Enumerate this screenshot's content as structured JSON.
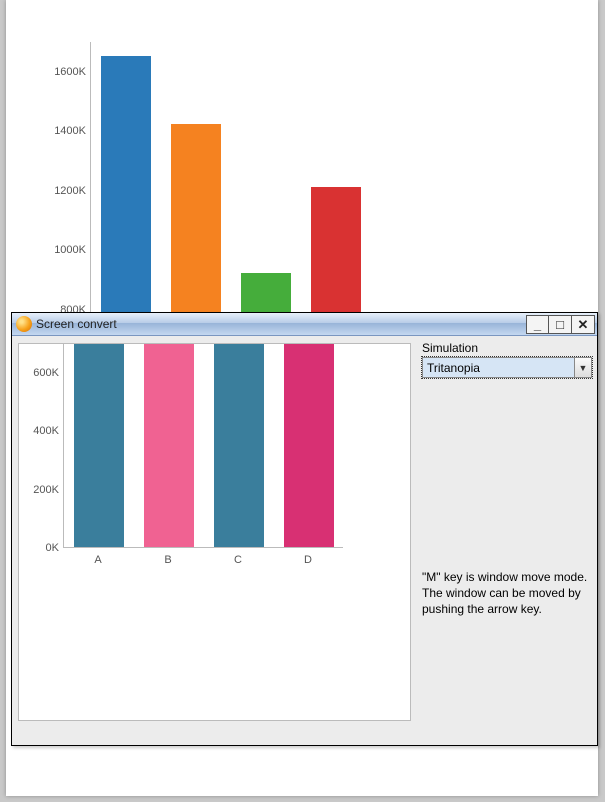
{
  "chart_data": {
    "type": "bar",
    "categories": [
      "A",
      "B",
      "C",
      "D"
    ],
    "values": [
      1650000,
      1420000,
      920000,
      1210000
    ],
    "colors": [
      "#2a7ab9",
      "#f58220",
      "#45ad3b",
      "#d93232"
    ],
    "sim_colors": [
      "#3a7e9c",
      "#f06292",
      "#3a7e9c",
      "#d83073"
    ],
    "ylim": [
      0,
      1700000
    ],
    "ylim_sim": [
      0,
      700000
    ],
    "yticks": [
      "0K",
      "200K",
      "400K",
      "600K",
      "800K",
      "1000K",
      "1200K",
      "1400K",
      "1600K"
    ],
    "yticks_sim": [
      "0K",
      "200K",
      "400K",
      "600K"
    ],
    "title": "",
    "xlabel": "",
    "ylabel": ""
  },
  "dialog": {
    "title": "Screen convert",
    "simulation_label": "Simulation",
    "simulation_value": "Tritanopia",
    "hint": "\"M\" key is window move mode. The window can be moved by pushing the arrow key."
  },
  "window_controls": {
    "minimize": "_",
    "maximize": "□",
    "close": "✕"
  }
}
